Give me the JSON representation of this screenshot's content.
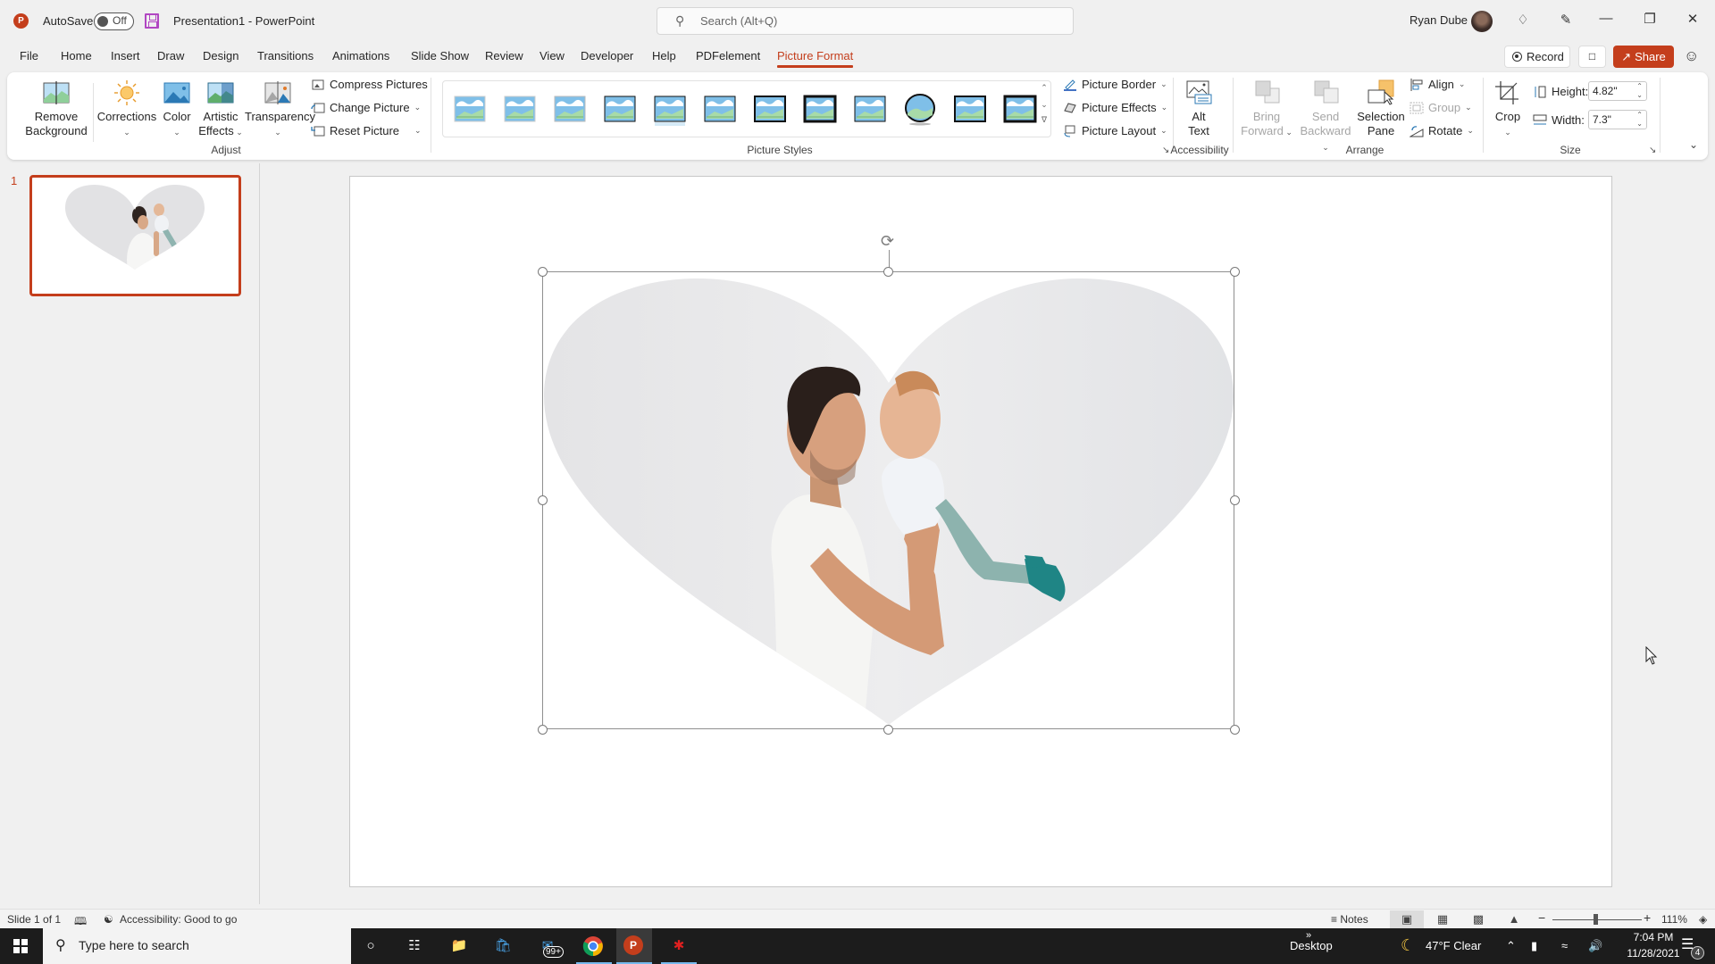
{
  "titlebar": {
    "app_icon": "powerpoint-logo-icon",
    "autosave_label": "AutoSave",
    "autosave_state": "Off",
    "document_title": "Presentation1  -  PowerPoint",
    "search_placeholder": "Search (Alt+Q)",
    "user_name": "Ryan Dube",
    "window_buttons": [
      "minimize",
      "restore",
      "close"
    ]
  },
  "tabs": [
    {
      "label": "File"
    },
    {
      "label": "Home"
    },
    {
      "label": "Insert"
    },
    {
      "label": "Draw"
    },
    {
      "label": "Design"
    },
    {
      "label": "Transitions"
    },
    {
      "label": "Animations"
    },
    {
      "label": "Slide Show"
    },
    {
      "label": "Review"
    },
    {
      "label": "View"
    },
    {
      "label": "Developer"
    },
    {
      "label": "Help"
    },
    {
      "label": "PDFelement"
    },
    {
      "label": "Picture Format",
      "active": true
    }
  ],
  "actions": {
    "record_label": "Record",
    "share_label": "Share"
  },
  "ribbon": {
    "adjust": {
      "group_label": "Adjust",
      "remove_background": "Remove Background",
      "remove_background_l1": "Remove",
      "remove_background_l2": "Background",
      "corrections": "Corrections",
      "color": "Color",
      "artistic_effects_l1": "Artistic",
      "artistic_effects_l2": "Effects",
      "transparency": "Transparency",
      "compress_pictures": "Compress Pictures",
      "change_picture": "Change Picture",
      "reset_picture": "Reset Picture"
    },
    "picture_styles": {
      "group_label": "Picture Styles",
      "style_count": 12,
      "picture_border": "Picture Border",
      "picture_effects": "Picture Effects",
      "picture_layout": "Picture Layout"
    },
    "accessibility": {
      "group_label": "Accessibility",
      "alt_text_l1": "Alt",
      "alt_text_l2": "Text"
    },
    "arrange": {
      "group_label": "Arrange",
      "bring_forward_l1": "Bring",
      "bring_forward_l2": "Forward",
      "send_backward_l1": "Send",
      "send_backward_l2": "Backward",
      "selection_pane_l1": "Selection",
      "selection_pane_l2": "Pane",
      "align": "Align",
      "group": "Group",
      "rotate": "Rotate"
    },
    "size": {
      "group_label": "Size",
      "crop": "Crop",
      "height_label": "Height:",
      "height_value": "4.82\"",
      "width_label": "Width:",
      "width_value": "7.3\""
    }
  },
  "slides_panel": {
    "slides": [
      {
        "number": "1",
        "selected": true
      }
    ]
  },
  "slide": {
    "content": "heart-cropped photo of father lifting baby",
    "selected_object": "picture"
  },
  "statusbar": {
    "slide_indicator": "Slide 1 of 1",
    "accessibility": "Accessibility: Good to go",
    "notes_label": "Notes",
    "zoom_level": "111%"
  },
  "taskbar": {
    "search_placeholder": "Type here to search",
    "mail_badge": "99+",
    "desktop_label": "Desktop",
    "weather": "47°F  Clear",
    "time": "7:04 PM",
    "date": "11/28/2021",
    "notification_count": "4"
  },
  "colors": {
    "accent": "#c43e1c",
    "share_bg": "#c43e1c",
    "taskbar_bg": "#1c1c1c"
  }
}
